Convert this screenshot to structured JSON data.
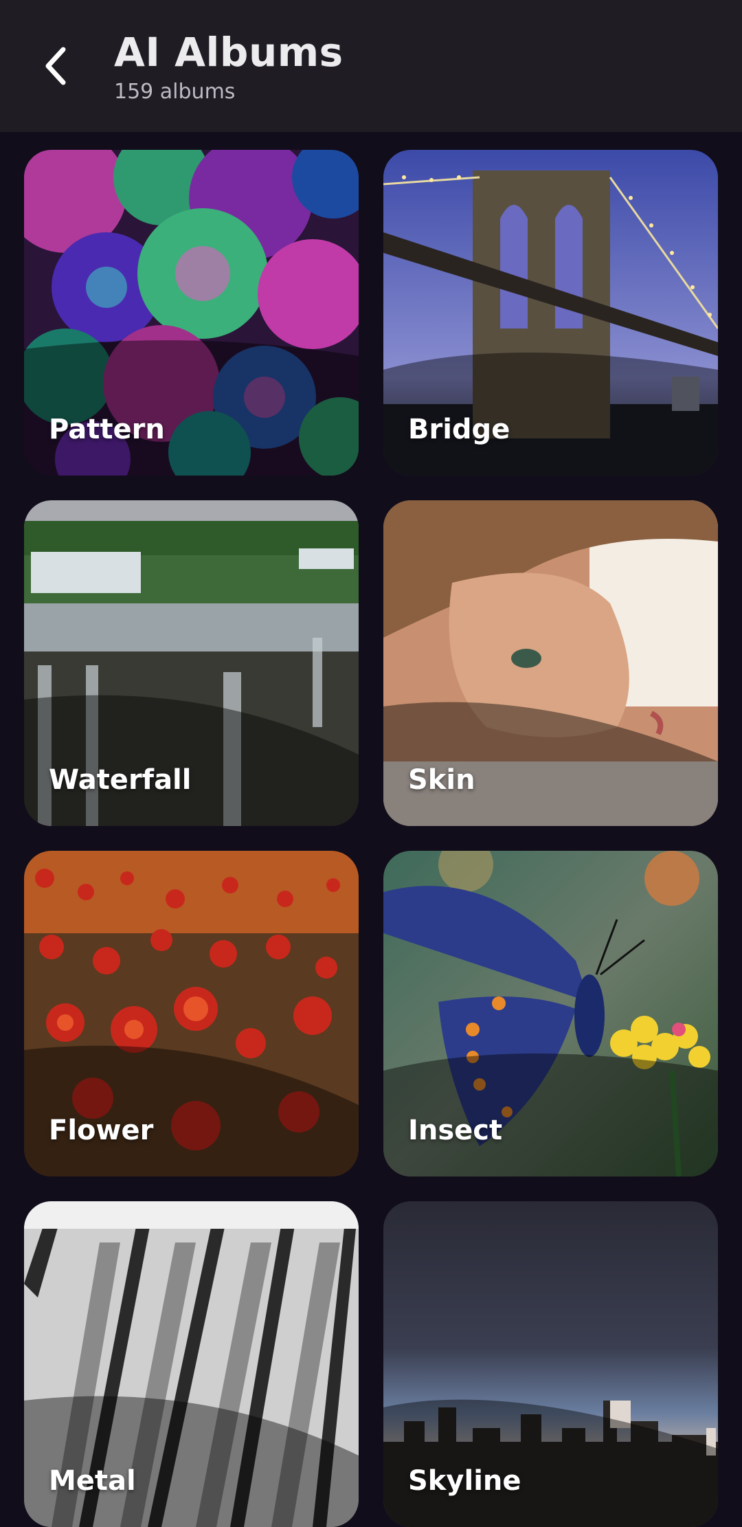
{
  "header": {
    "title": "AI Albums",
    "subtitle": "159 albums",
    "back_icon": "chevron-left-icon"
  },
  "albums": [
    {
      "label": "Pattern"
    },
    {
      "label": "Bridge"
    },
    {
      "label": "Waterfall"
    },
    {
      "label": "Skin"
    },
    {
      "label": "Flower"
    },
    {
      "label": "Insect"
    },
    {
      "label": "Metal"
    },
    {
      "label": "Skyline"
    }
  ],
  "colors": {
    "background": "#110d1a",
    "header": "#1f1d23",
    "title": "#ecebee",
    "subtitle": "#bdbac4"
  }
}
